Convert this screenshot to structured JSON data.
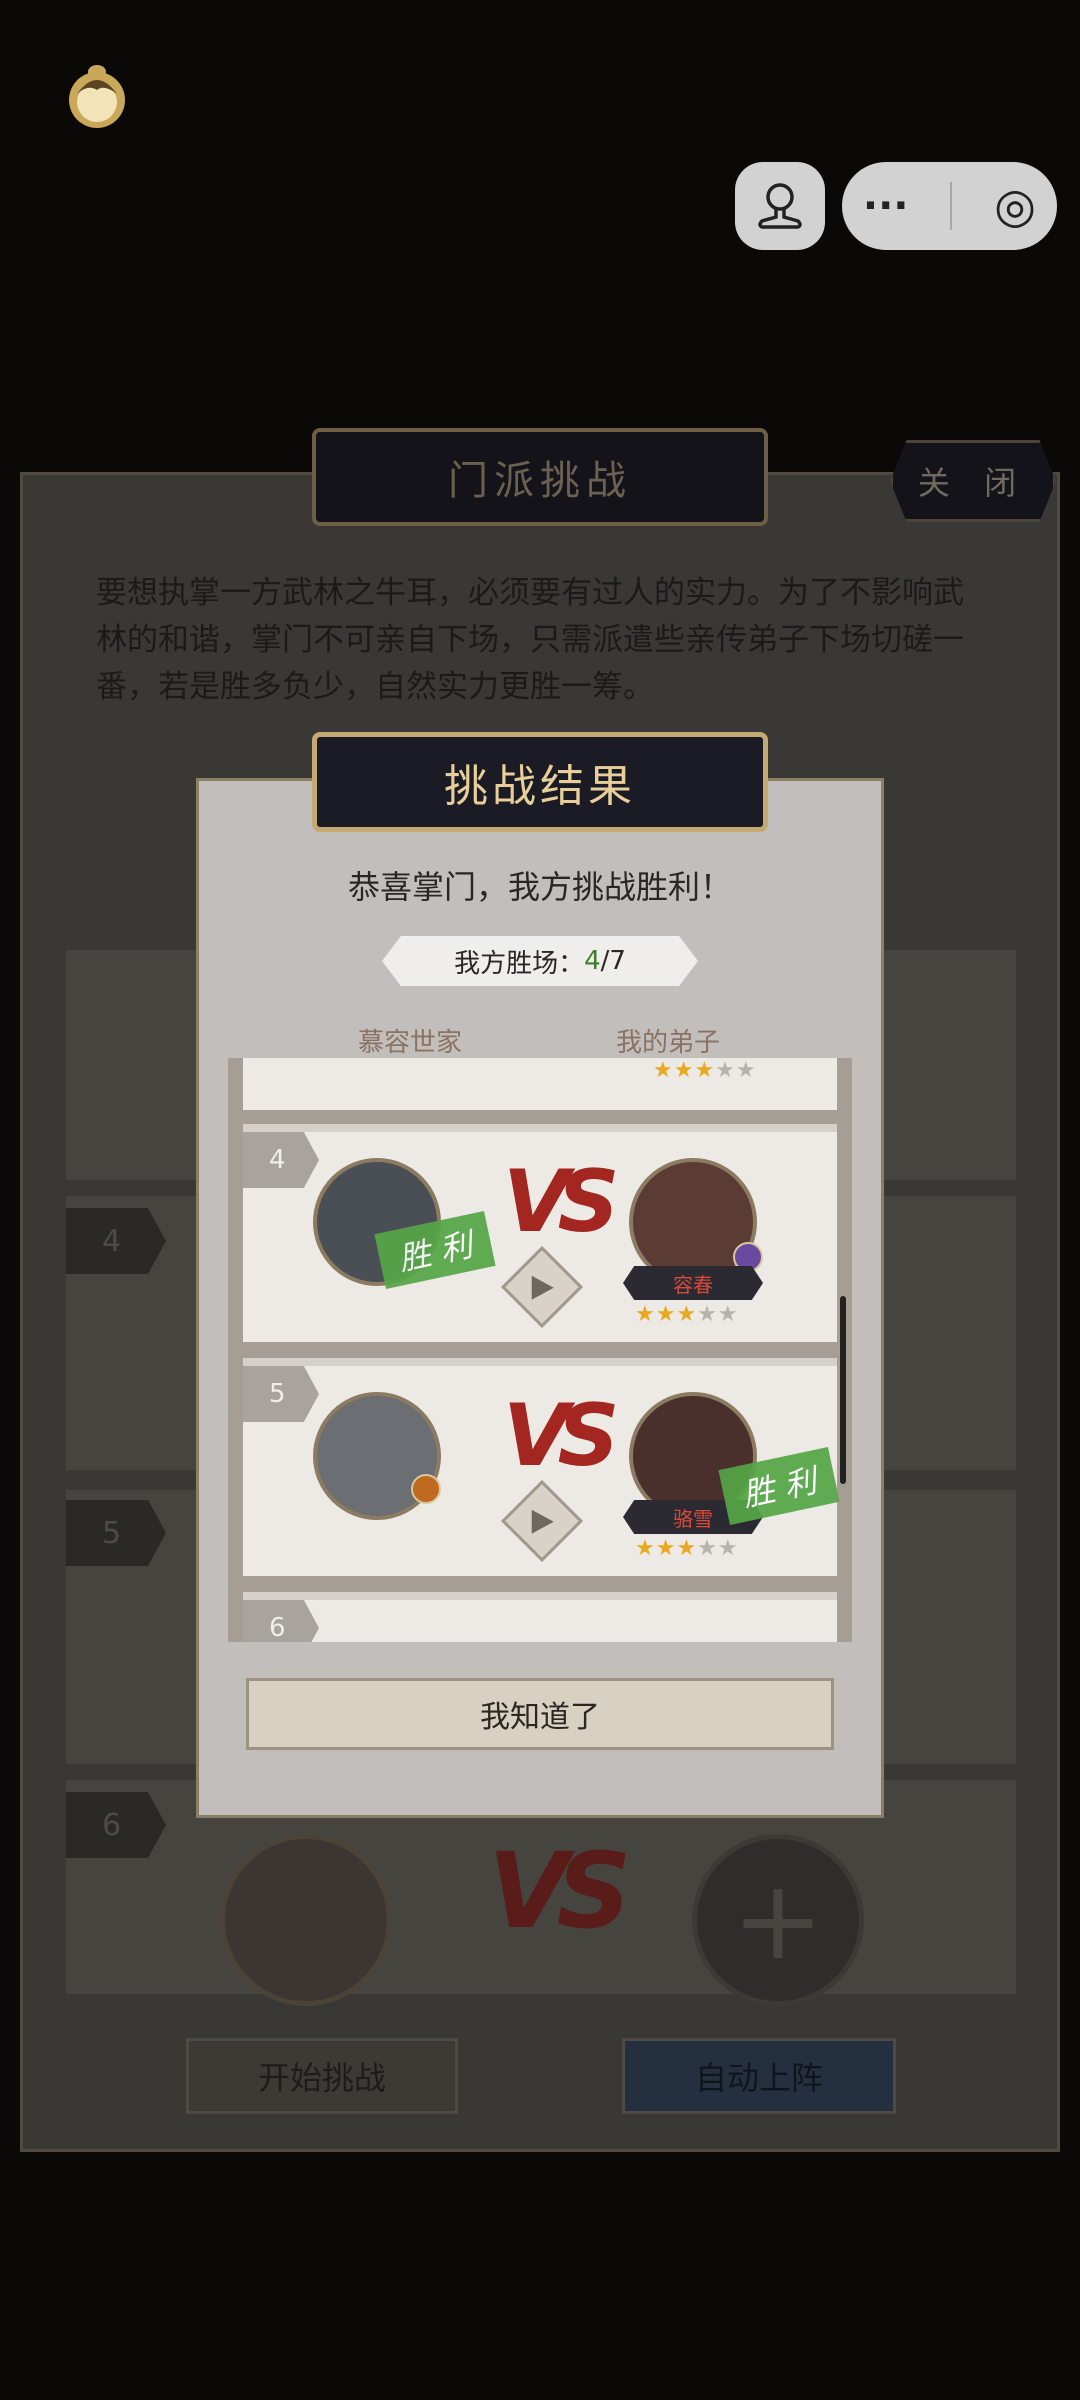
{
  "top_bar": {
    "avatar_icon": "user-avatar-icon",
    "capsule_more": "···",
    "capsule_record": "◎"
  },
  "main_panel": {
    "title": "门派挑战",
    "close_label": "关 闭",
    "intro": "要想执掌一方武林之牛耳，必须要有过人的实力。为了不影响武林的和谐，掌门不可亲自下场，只需派遣些亲传弟子下场切磋一番，若是胜多负少，自然实力更胜一筹。",
    "slots": [
      {
        "num": "4"
      },
      {
        "num": "5"
      },
      {
        "num": "6"
      }
    ],
    "start_button": "开始挑战",
    "auto_button": "自动上阵"
  },
  "modal": {
    "title": "挑战结果",
    "congrats": "恭喜掌门，我方挑战胜利！",
    "wins_label": "我方胜场：",
    "wins_value": "4",
    "wins_total": "/7",
    "col_left": "慕容世家",
    "col_right": "我的弟子",
    "rows": [
      {
        "num": "4",
        "vs": "VS",
        "right_name": "容春",
        "stars": 3,
        "max_stars": 5,
        "winner": "left",
        "win_label": "胜 利"
      },
      {
        "num": "5",
        "vs": "VS",
        "right_name": "骆雪",
        "stars": 3,
        "max_stars": 5,
        "winner": "right",
        "win_label": "胜 利"
      },
      {
        "num": "6"
      }
    ],
    "ok_button": "我知道了"
  },
  "colors": {
    "accent_gold": "#c4aa72",
    "vs_red": "#a32620",
    "win_green": "#55a646",
    "star_gold": "#e8a820"
  }
}
